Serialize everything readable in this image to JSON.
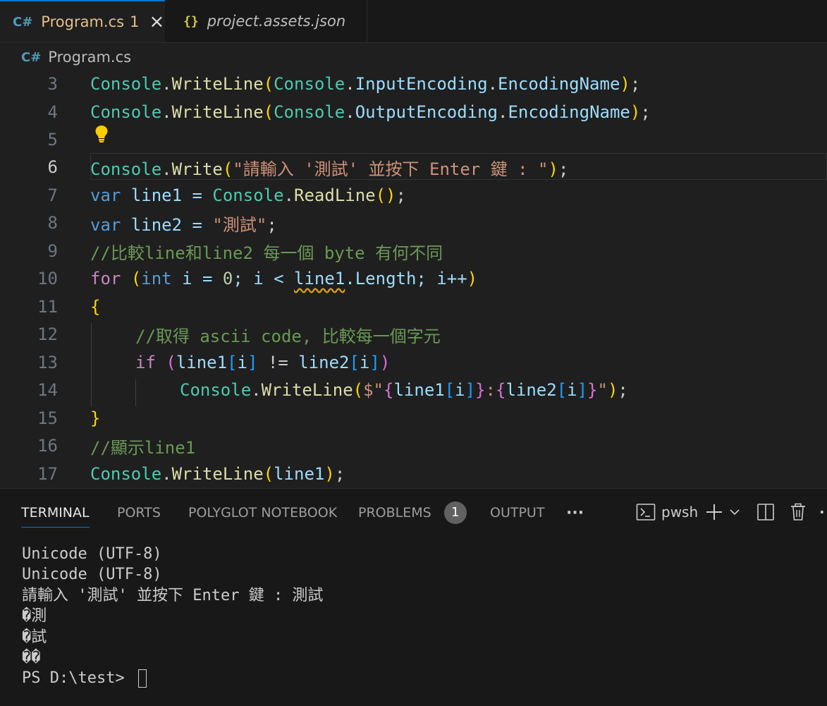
{
  "tabs": {
    "active": {
      "icon_text": "C#",
      "icon": "csharp-icon",
      "label": "Program.cs",
      "badge": "1",
      "close": "×"
    },
    "inactive": {
      "icon_text": "{}",
      "icon": "json-braces-icon",
      "label": "project.assets.json"
    }
  },
  "breadcrumb": {
    "icon_text": "C#",
    "label": "Program.cs"
  },
  "editor": {
    "line_numbers": [
      "3",
      "4",
      "5",
      "6",
      "7",
      "8",
      "9",
      "10",
      "11",
      "12",
      "13",
      "14",
      "15",
      "16",
      "17"
    ],
    "current_line": "6",
    "lines": {
      "l3": {
        "a": "Console",
        "b": ".",
        "c": "WriteLine",
        "d": "(",
        "e": "Console",
        "f": ".",
        "g": "InputEncoding",
        "h": ".",
        "i": "EncodingName",
        "j": ")",
        ";": ";"
      },
      "l4": {
        "a": "Console",
        "b": ".",
        "c": "WriteLine",
        "d": "(",
        "e": "Console",
        "f": ".",
        "g": "OutputEncoding",
        "h": ".",
        "i": "EncodingName",
        "j": ")",
        ";": ";"
      },
      "l6": {
        "a": "Console",
        "b": ".",
        "c": "Write",
        "d": "(",
        "e": "\"請輸入 '測試' 並按下 Enter 鍵 : \"",
        "f": ")",
        "g": ";"
      },
      "l7": {
        "a": "var",
        "b": " line1 = ",
        "c": "Console",
        "d": ".",
        "e": "ReadLine",
        "f": "()",
        "g": ";"
      },
      "l8": {
        "a": "var",
        "b": " line2 = ",
        "c": "\"測試\"",
        "d": ";"
      },
      "l9": {
        "a": "//比較line和line2 每一個 byte 有何不同"
      },
      "l10": {
        "a": "for",
        "b": " ",
        "c": "(",
        "d": "int",
        "e": " i = ",
        "f": "0",
        "g": "; i < ",
        "h": "line1",
        "i": ".Length; i++",
        "j": ")"
      },
      "l11": {
        "a": "{"
      },
      "l12": {
        "a": "//取得 ascii code, 比較每一個字元"
      },
      "l13": {
        "a": "if",
        "b": " ",
        "c": "(",
        "d": "line1",
        "e": "[",
        "f": "i",
        "g": "]",
        "h": " != ",
        "i": "line2",
        "j": "[",
        "k": "i",
        "l": "]",
        "m": ")"
      },
      "l14": {
        "a": "Console",
        "b": ".",
        "c": "WriteLine",
        "d": "(",
        "e": "$\"",
        "f": "{",
        "g": "line1",
        "h": "[",
        "i": "i",
        "j": "]",
        "k": "}",
        "l": ":",
        "m": "{",
        "n": "line2",
        "o": "[",
        "p": "i",
        "q": "]",
        "r": "}",
        "s": "\"",
        "t": ")",
        "u": ";"
      },
      "l15": {
        "a": "}"
      },
      "l16": {
        "a": "//顯示line1"
      },
      "l17": {
        "a": "Console",
        "b": ".",
        "c": "WriteLine",
        "d": "(",
        "e": "line1",
        "f": ")",
        "g": ";"
      }
    },
    "lightbulb_icon": "lightbulb-icon"
  },
  "panel": {
    "tabs": [
      "TERMINAL",
      "PORTS",
      "POLYGLOT NOTEBOOK",
      "PROBLEMS",
      "OUTPUT"
    ],
    "problems_count": "1",
    "more": "···",
    "shell_name": "pwsh",
    "terminal_lines": [
      "Unicode (UTF-8)",
      "Unicode (UTF-8)",
      "請輸入 '測試' 並按下 Enter 鍵 : 測試",
      "�測",
      "�試",
      "��"
    ],
    "prompt": "PS D:\\test> "
  },
  "colors": {
    "accent": "#0078d4",
    "editor_bg": "#1f1f1f",
    "panel_bg": "#181818",
    "tab_modified": "#e2c08d"
  }
}
